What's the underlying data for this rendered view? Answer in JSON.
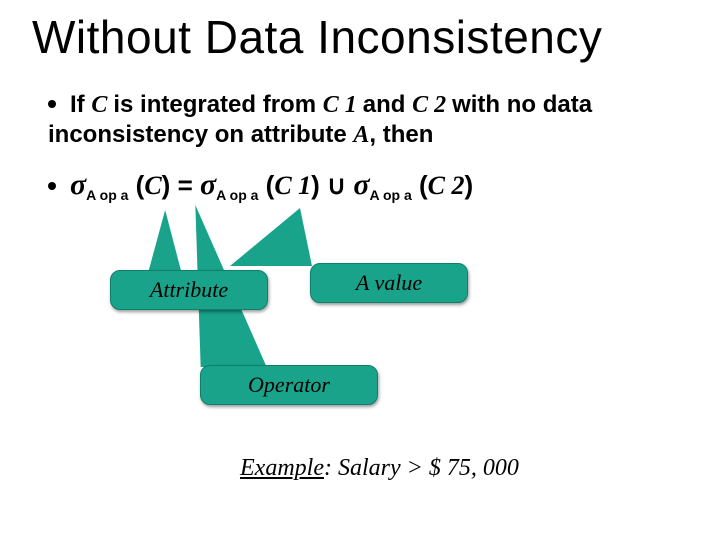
{
  "title": "Without Data Inconsistency",
  "bullet": {
    "prefix": "If ",
    "c": "C ",
    "mid1": " is integrated from ",
    "c1": "C 1 ",
    "and": " and ",
    "c2": "C 2 ",
    "mid2": "with no data inconsistency on attribute ",
    "a": "A",
    "suffix": ", then"
  },
  "equation": {
    "sigma": "σ",
    "sub": "A op a",
    "lp": " (",
    "c": "C",
    "rp": ") ",
    "eq": "= ",
    "c1": "C 1",
    "union": " ∪ ",
    "c2": "C 2"
  },
  "callouts": {
    "attribute": "Attribute",
    "value": "A value",
    "operator": "Operator"
  },
  "example": {
    "label": "Example",
    "sep": ":  ",
    "text": "Salary > $ 75, 000"
  }
}
